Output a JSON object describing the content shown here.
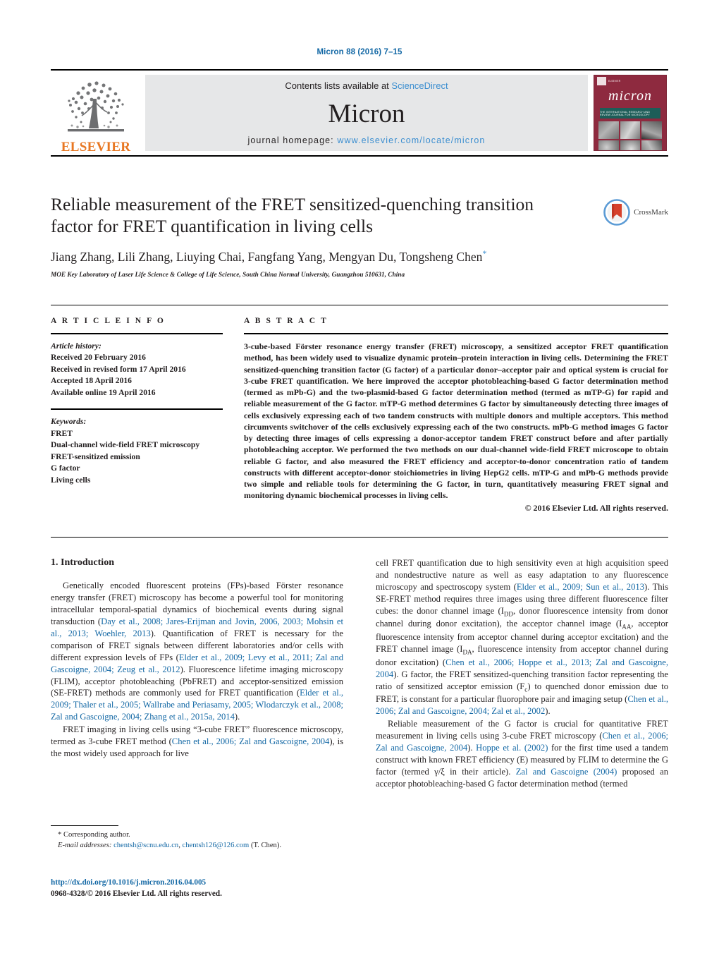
{
  "running_head": "Micron 88 (2016) 7–15",
  "masthead": {
    "publisher_name": "ELSEVIER",
    "contents_prefix": "Contents lists available at ",
    "sciencedirect": "ScienceDirect",
    "journal_name": "Micron",
    "homepage_prefix": "journal homepage: ",
    "homepage_url": "www.elsevier.com/locate/micron",
    "cover_title": "micron",
    "cover_subtitle": "THE INTERNATIONAL RESEARCH AND REVIEW JOURNAL FOR MICROSCOPY",
    "cover_publisher": "ELSEVIER"
  },
  "article": {
    "title": "Reliable measurement of the FRET sensitized-quenching transition factor for FRET quantification in living cells",
    "authors": "Jiang Zhang, Lili Zhang, Liuying Chai, Fangfang Yang, Mengyan Du, Tongsheng Chen",
    "corresponding_marker": "*",
    "affiliation": "MOE Key Laboratory of Laser Life Science & College of Life Science, South China Normal University, Guangzhou 510631, China",
    "crossmark_label": "CrossMark"
  },
  "info": {
    "heading": "A R T I C L E    I N F O",
    "history_label": "Article history:",
    "history": [
      "Received 20 February 2016",
      "Received in revised form 17 April 2016",
      "Accepted 18 April 2016",
      "Available online 19 April 2016"
    ],
    "keywords_label": "Keywords:",
    "keywords": [
      "FRET",
      "Dual-channel wide-field FRET microscopy",
      "FRET-sensitized emission",
      "G factor",
      "Living cells"
    ]
  },
  "abstract": {
    "heading": "A B S T R A C T",
    "text": "3-cube-based Förster resonance energy transfer (FRET) microscopy, a sensitized acceptor FRET quantification method, has been widely used to visualize dynamic protein–protein interaction in living cells. Determining the FRET sensitized-quenching transition factor (G factor) of a particular donor–acceptor pair and optical system is crucial for 3-cube FRET quantification. We here improved the acceptor photobleaching-based G factor determination method (termed as mPb-G) and the two-plasmid-based G factor determination method (termed as mTP-G) for rapid and reliable measurement of the G factor. mTP-G method determines G factor by simultaneously detecting three images of cells exclusively expressing each of two tandem constructs with multiple donors and multiple acceptors. This method circumvents switchover of the cells exclusively expressing each of the two constructs. mPb-G method images G factor by detecting three images of cells expressing a donor-acceptor tandem FRET construct before and after partially photobleaching acceptor. We performed the two methods on our dual-channel wide-field FRET microscope to obtain reliable G factor, and also measured the FRET efficiency and acceptor-to-donor concentration ratio of tandem constructs with different acceptor-donor stoichiometries in living HepG2 cells. mTP-G and mPb-G methods provide two simple and reliable tools for determining the G factor, in turn, quantitatively measuring FRET signal and monitoring dynamic biochemical processes in living cells.",
    "copyright": "© 2016 Elsevier Ltd. All rights reserved."
  },
  "body": {
    "section_heading": "1. Introduction",
    "left_paragraph_1_a": "Genetically encoded fluorescent proteins (FPs)-based Förster resonance energy transfer (FRET) microscopy has become a powerful tool for monitoring intracellular temporal-spatial dynamics of biochemical events during signal transduction (",
    "left_p1_ref1": "Day et al., 2008; Jares-Erijman and Jovin, 2006, 2003; Mohsin et al., 2013; Woehler, 2013",
    "left_paragraph_1_b": "). Quantification of FRET is necessary for the comparison of FRET signals between different laboratories and/or cells with different expression levels of FPs (",
    "left_p1_ref2": "Elder et al., 2009; Levy et al., 2011; Zal and Gascoigne, 2004; Zeug et al., 2012",
    "left_paragraph_1_c": "). Fluorescence lifetime imaging microscopy (FLIM), acceptor photobleaching (PbFRET) and acceptor-sensitized emission (SE-FRET) methods are commonly used for FRET quantification (",
    "left_p1_ref3": "Elder et al., 2009; Thaler et al., 2005; Wallrabe and Periasamy, 2005; Wlodarczyk et al., 2008; Zal and Gascoigne, 2004; Zhang et al., 2015a, 2014",
    "left_paragraph_1_d": ").",
    "left_paragraph_2_a": "FRET imaging in living cells using “3-cube FRET” fluorescence microscopy, termed as 3-cube FRET method (",
    "left_p2_ref1": "Chen et al., 2006; Zal and Gascoigne, 2004",
    "left_paragraph_2_b": "), is the most widely used approach for live",
    "right_paragraph_1_a": "cell FRET quantification due to high sensitivity even at high acquisition speed and nondestructive nature as well as easy adaptation to any fluorescence microscopy and spectroscopy system (",
    "right_p1_ref1": "Elder et al., 2009; Sun et al., 2013",
    "right_paragraph_1_b": "). This SE-FRET method requires three images using three different fluorescence filter cubes: the donor channel image (I",
    "right_sub_dd": "DD",
    "right_paragraph_1_c": ", donor fluorescence intensity from donor channel during donor excitation), the acceptor channel image (I",
    "right_sub_aa": "AA",
    "right_paragraph_1_d": ", acceptor fluorescence intensity from acceptor channel during acceptor excitation) and the FRET channel image (I",
    "right_sub_da": "DA",
    "right_paragraph_1_e": ", fluorescence intensity from acceptor channel during donor excitation) (",
    "right_p1_ref2": "Chen et al., 2006; Hoppe et al., 2013; Zal and Gascoigne, 2004",
    "right_paragraph_1_f": "). G factor, the FRET sensitized-quenching transition factor representing the ratio of sensitized acceptor emission (F",
    "right_sub_c": "c",
    "right_paragraph_1_g": ") to quenched donor emission due to FRET, is constant for a particular fluorophore pair and imaging setup (",
    "right_p1_ref3": "Chen et al., 2006; Zal and Gascoigne, 2004; Zal et al., 2002",
    "right_paragraph_1_h": ").",
    "right_paragraph_2_a": "Reliable measurement of the G factor is crucial for quantitative FRET measurement in living cells using 3-cube FRET microscopy (",
    "right_p2_ref1": "Chen et al., 2006; Zal and Gascoigne, 2004",
    "right_paragraph_2_b": "). ",
    "right_p2_ref2": "Hoppe et al. (2002)",
    "right_paragraph_2_c": " for the first time used a tandem construct with known FRET efficiency (E) measured by FLIM to determine the G factor (termed γ/ξ in their article). ",
    "right_p2_ref3": "Zal and Gascoigne (2004)",
    "right_paragraph_2_d": " proposed an acceptor photobleaching-based G factor determination method (termed"
  },
  "footnote": {
    "corresponding_marker": "*",
    "corresponding_text": "Corresponding author.",
    "email_label": "E-mail addresses:",
    "email1": "chentsh@scnu.edu.cn",
    "email_sep": ", ",
    "email2": "chentsh126@126.com",
    "email_owner": " (T. Chen)."
  },
  "footer": {
    "doi": "http://dx.doi.org/10.1016/j.micron.2016.04.005",
    "issn_line": "0968-4328/© 2016 Elsevier Ltd. All rights reserved."
  },
  "colors": {
    "link": "#1368a5",
    "sciencedirect": "#3b8ed0",
    "elsevier_orange": "#e87722",
    "cover_maroon": "#8e2a3f",
    "band_gray": "#e6e7e8"
  }
}
